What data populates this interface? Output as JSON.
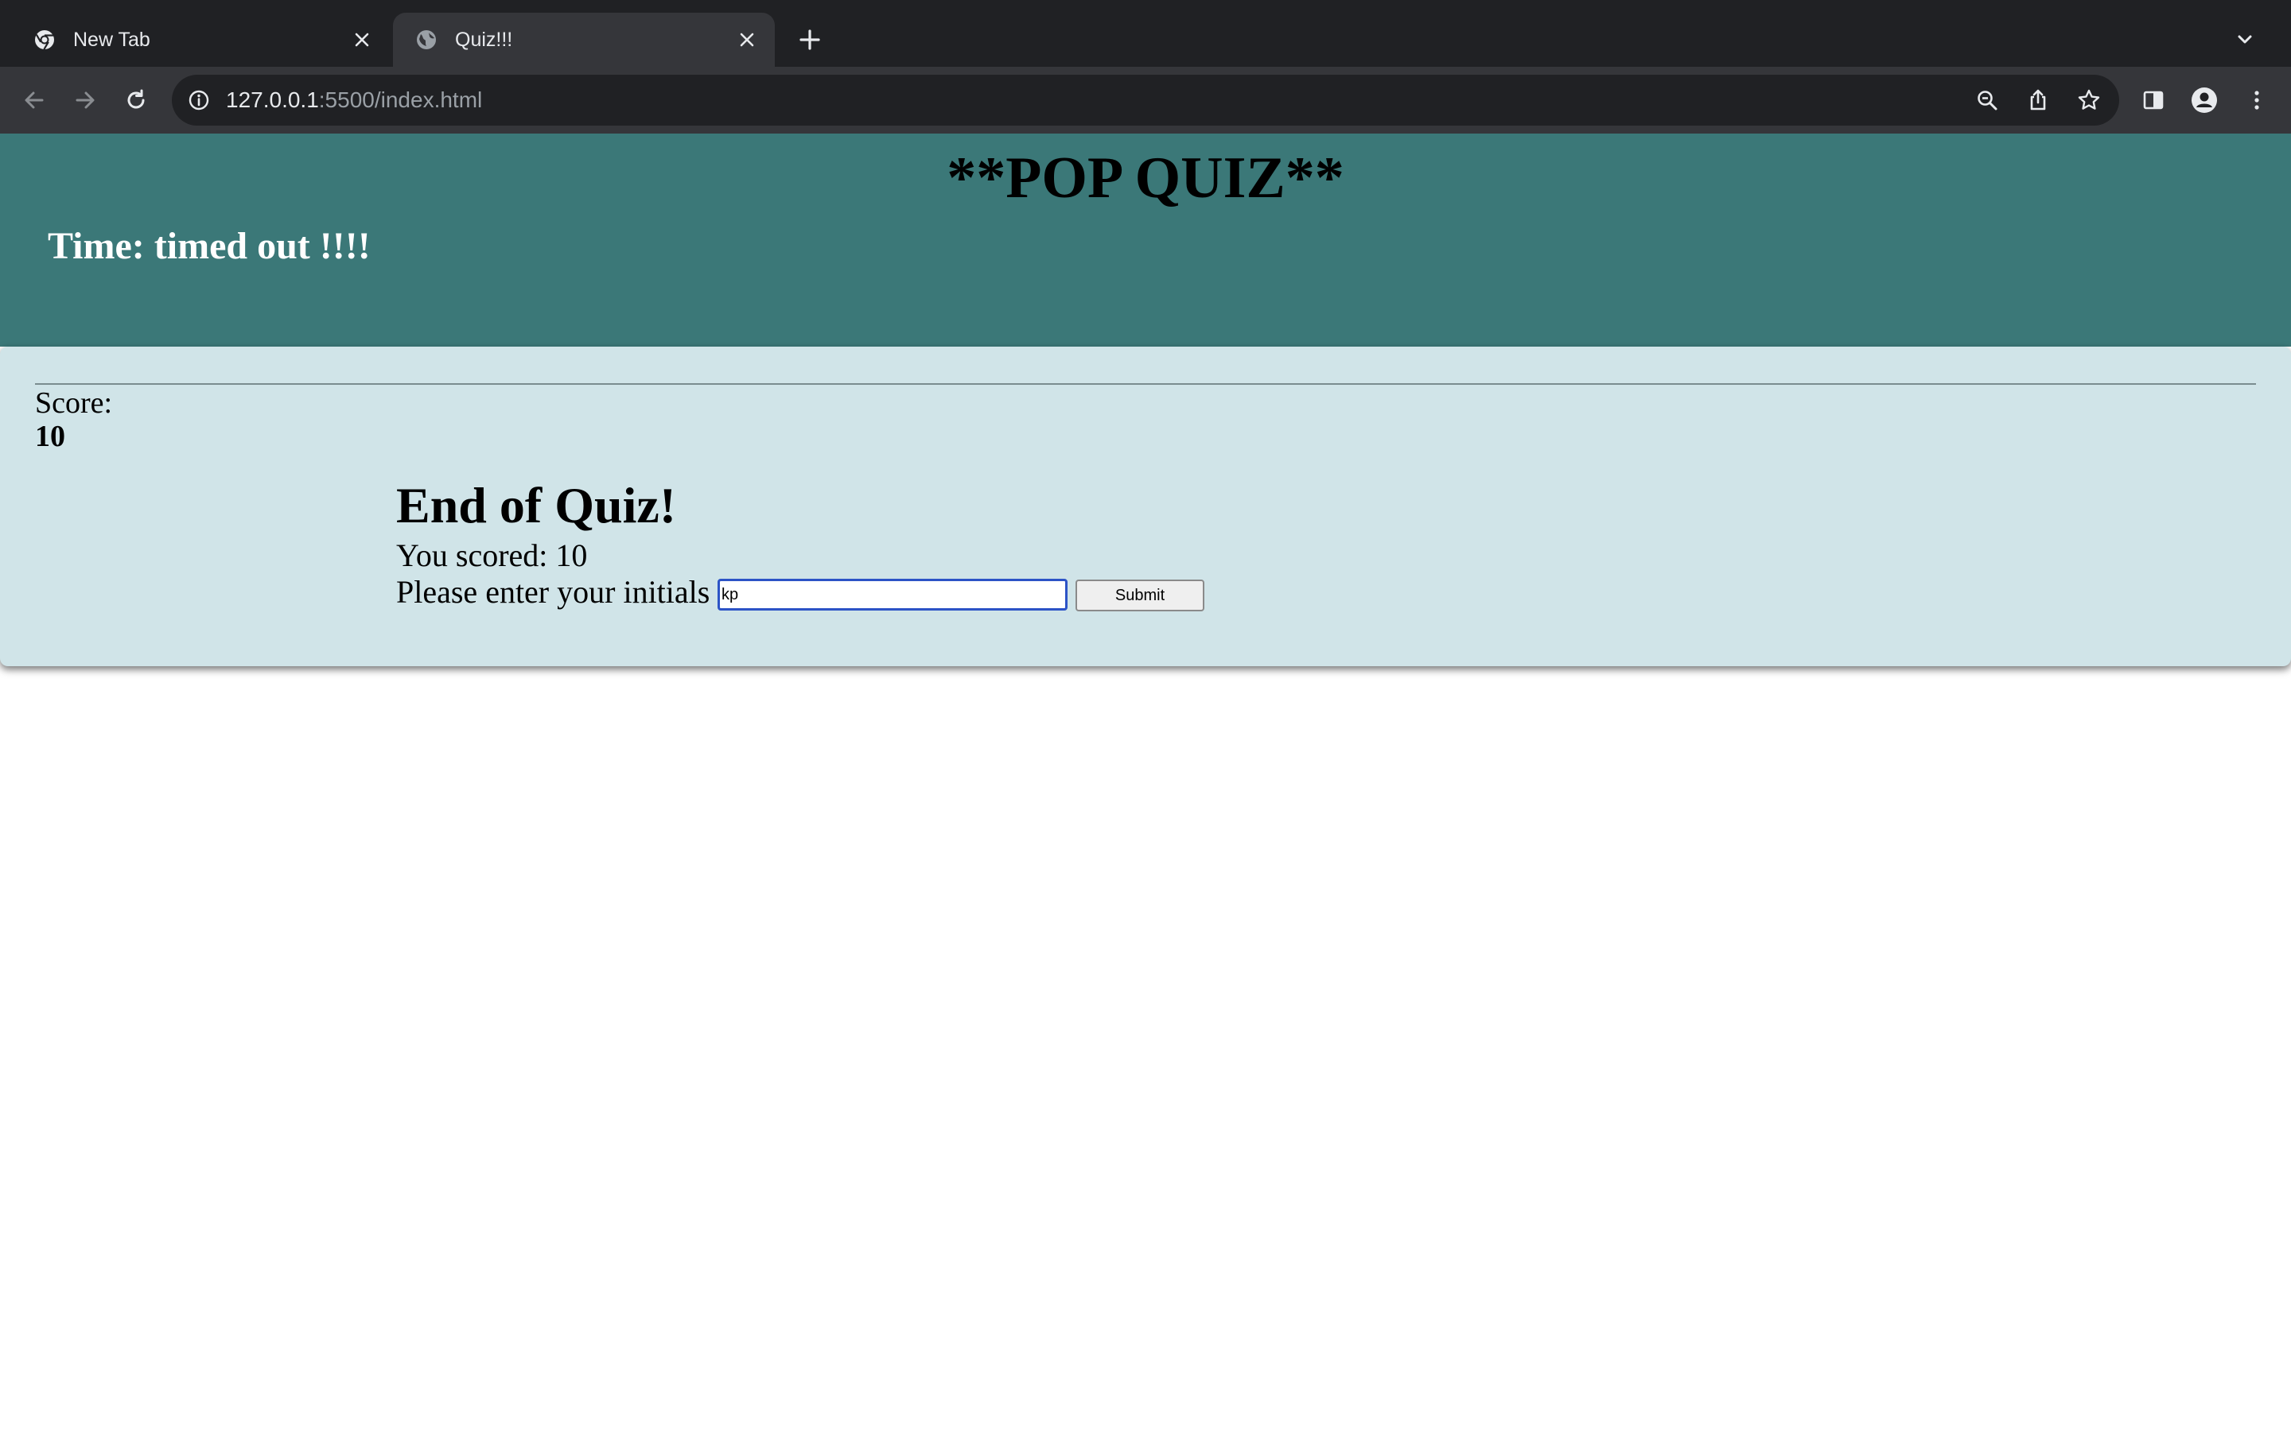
{
  "browser": {
    "tabs": [
      {
        "title": "New Tab",
        "icon": "chrome-icon",
        "active": false
      },
      {
        "title": "Quiz!!!",
        "icon": "globe-icon",
        "active": true
      }
    ],
    "address_bar": {
      "url_host": "127.0.0.1",
      "url_rest": ":5500/index.html"
    },
    "colors": {
      "tabstrip": "#202124",
      "toolbar": "#35363a",
      "omnibox": "#202124",
      "text": "#e8eaed"
    }
  },
  "page": {
    "header": {
      "title": "**POP QUIZ**",
      "timer_text": "Time: timed out !!!!"
    },
    "score": {
      "label": "Score:",
      "value": "10"
    },
    "end": {
      "title": "End of Quiz!",
      "final_score_text": "You scored: 10",
      "initials_label": "Please enter your initials",
      "initials_value": "kp",
      "submit_label": "Submit"
    },
    "colors": {
      "header_bg": "#3b7878",
      "card_bg": "#d0e4e8",
      "input_focus": "#2c53c6"
    }
  }
}
